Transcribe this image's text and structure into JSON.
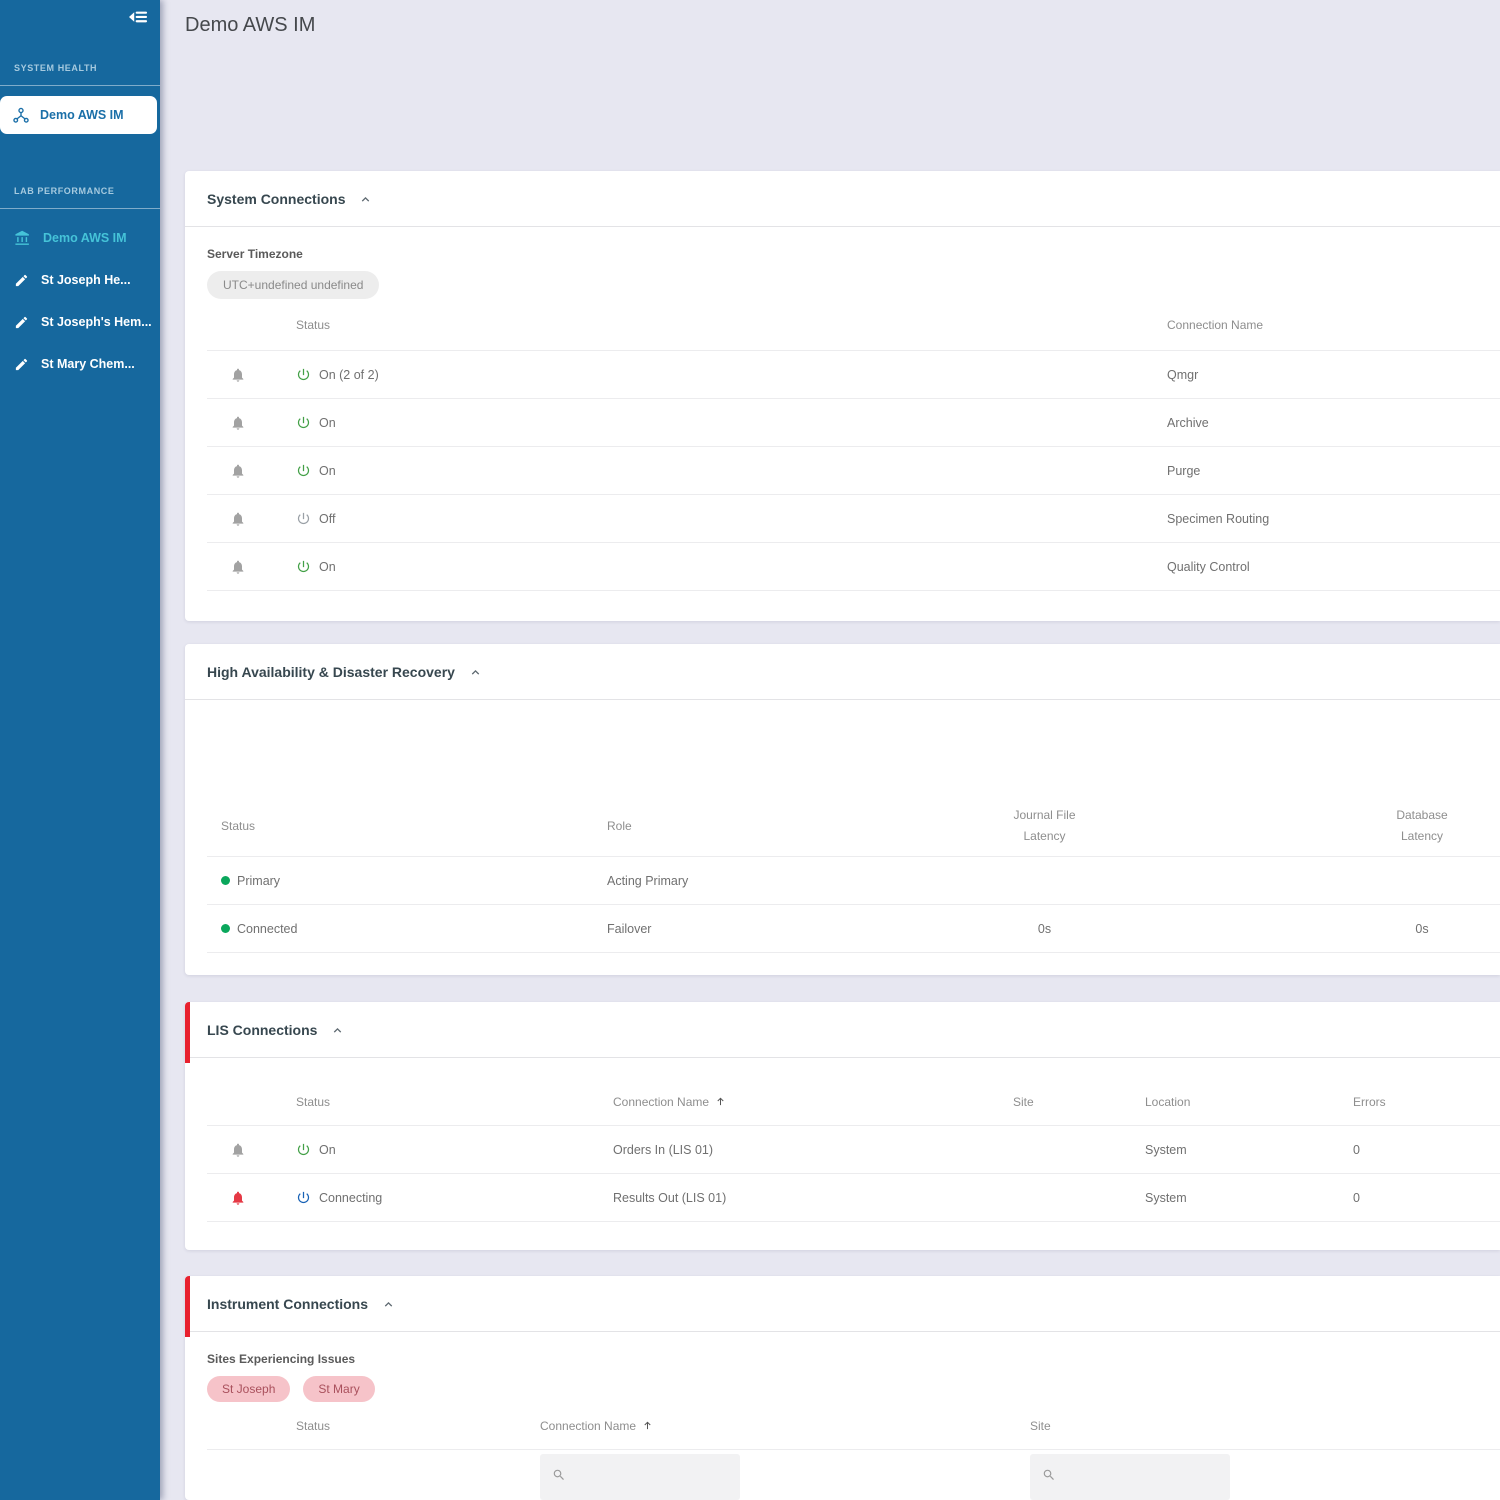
{
  "colors": {
    "sidebar_blue": "#16689e",
    "alert_red": "#e8212e",
    "power_on_green": "#43a047",
    "power_connecting_blue": "#1862b5",
    "status_dot_green": "#0aa75c",
    "site_issue_pink": "#f6c3c9"
  },
  "sidebar": {
    "sections": [
      {
        "label": "SYSTEM HEALTH",
        "items": [
          {
            "label": "Demo AWS IM",
            "icon": "hub-icon",
            "active": true
          }
        ]
      },
      {
        "label": "LAB PERFORMANCE",
        "items": [
          {
            "label": "Demo AWS IM",
            "icon": "bank-icon",
            "highlight": "cyan"
          },
          {
            "label": "St Joseph He...",
            "icon": "pencil-icon"
          },
          {
            "label": "St Joseph's Hem...",
            "icon": "pencil-icon"
          },
          {
            "label": "St Mary Chem...",
            "icon": "pencil-icon"
          }
        ]
      }
    ]
  },
  "header": {
    "title": "Demo AWS IM"
  },
  "system_connections": {
    "title": "System Connections",
    "server_timezone_label": "Server Timezone",
    "server_timezone_value": "UTC+undefined undefined",
    "columns": {
      "status": "Status",
      "connection_name": "Connection Name"
    },
    "rows": [
      {
        "bell": "normal",
        "power": "on",
        "status": "On (2 of 2)",
        "name": "Qmgr"
      },
      {
        "bell": "normal",
        "power": "on",
        "status": "On",
        "name": "Archive"
      },
      {
        "bell": "normal",
        "power": "on",
        "status": "On",
        "name": "Purge"
      },
      {
        "bell": "normal",
        "power": "off",
        "status": "Off",
        "name": "Specimen Routing"
      },
      {
        "bell": "normal",
        "power": "on",
        "status": "On",
        "name": "Quality Control"
      }
    ]
  },
  "hadr": {
    "title": "High Availability & Disaster Recovery",
    "columns": {
      "status": "Status",
      "role": "Role",
      "journal_line1": "Journal File",
      "journal_line2": "Latency",
      "database_line1": "Database",
      "database_line2": "Latency"
    },
    "rows": [
      {
        "status": "Primary",
        "role": "Acting Primary",
        "journal": "",
        "database": ""
      },
      {
        "status": "Connected",
        "role": "Failover",
        "journal": "0s",
        "database": "0s"
      }
    ]
  },
  "lis_connections": {
    "title": "LIS Connections",
    "columns": {
      "status": "Status",
      "connection_name": "Connection Name",
      "site": "Site",
      "location": "Location",
      "errors": "Errors"
    },
    "rows": [
      {
        "bell": "normal",
        "power": "on",
        "status": "On",
        "name": "Orders In (LIS 01)",
        "site": "",
        "location": "System",
        "errors": "0"
      },
      {
        "bell": "alert",
        "power": "connecting",
        "status": "Connecting",
        "name": "Results Out (LIS 01)",
        "site": "",
        "location": "System",
        "errors": "0"
      }
    ]
  },
  "instrument_connections": {
    "title": "Instrument Connections",
    "sites_issues_label": "Sites Experiencing Issues",
    "sites": [
      "St Joseph",
      "St Mary"
    ],
    "columns": {
      "status": "Status",
      "connection_name": "Connection Name",
      "site": "Site"
    }
  }
}
